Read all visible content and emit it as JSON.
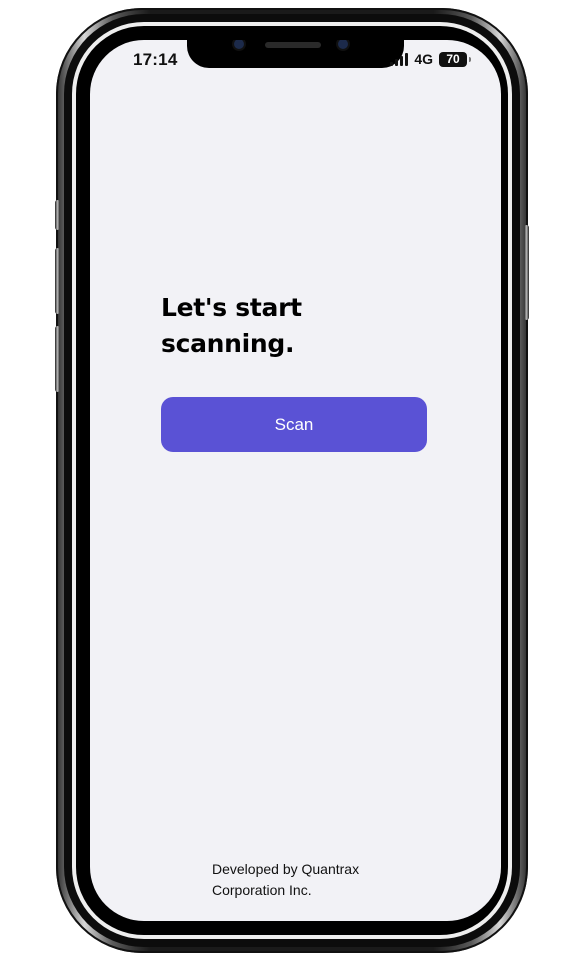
{
  "status_bar": {
    "time": "17:14",
    "network": "4G",
    "battery": "70"
  },
  "main": {
    "heading_line1": "Let's start",
    "heading_line2": "scanning.",
    "scan_button_label": "Scan"
  },
  "footer": {
    "line1": "Developed by Quantrax",
    "line2": "Corporation Inc."
  },
  "colors": {
    "accent": "#5a52d5",
    "screen_background": "#f2f2f6"
  },
  "icons": {
    "signal": "cellular-signal-icon",
    "battery": "battery-icon",
    "camera": "front-camera-icon",
    "speaker": "earpiece-speaker-icon"
  }
}
